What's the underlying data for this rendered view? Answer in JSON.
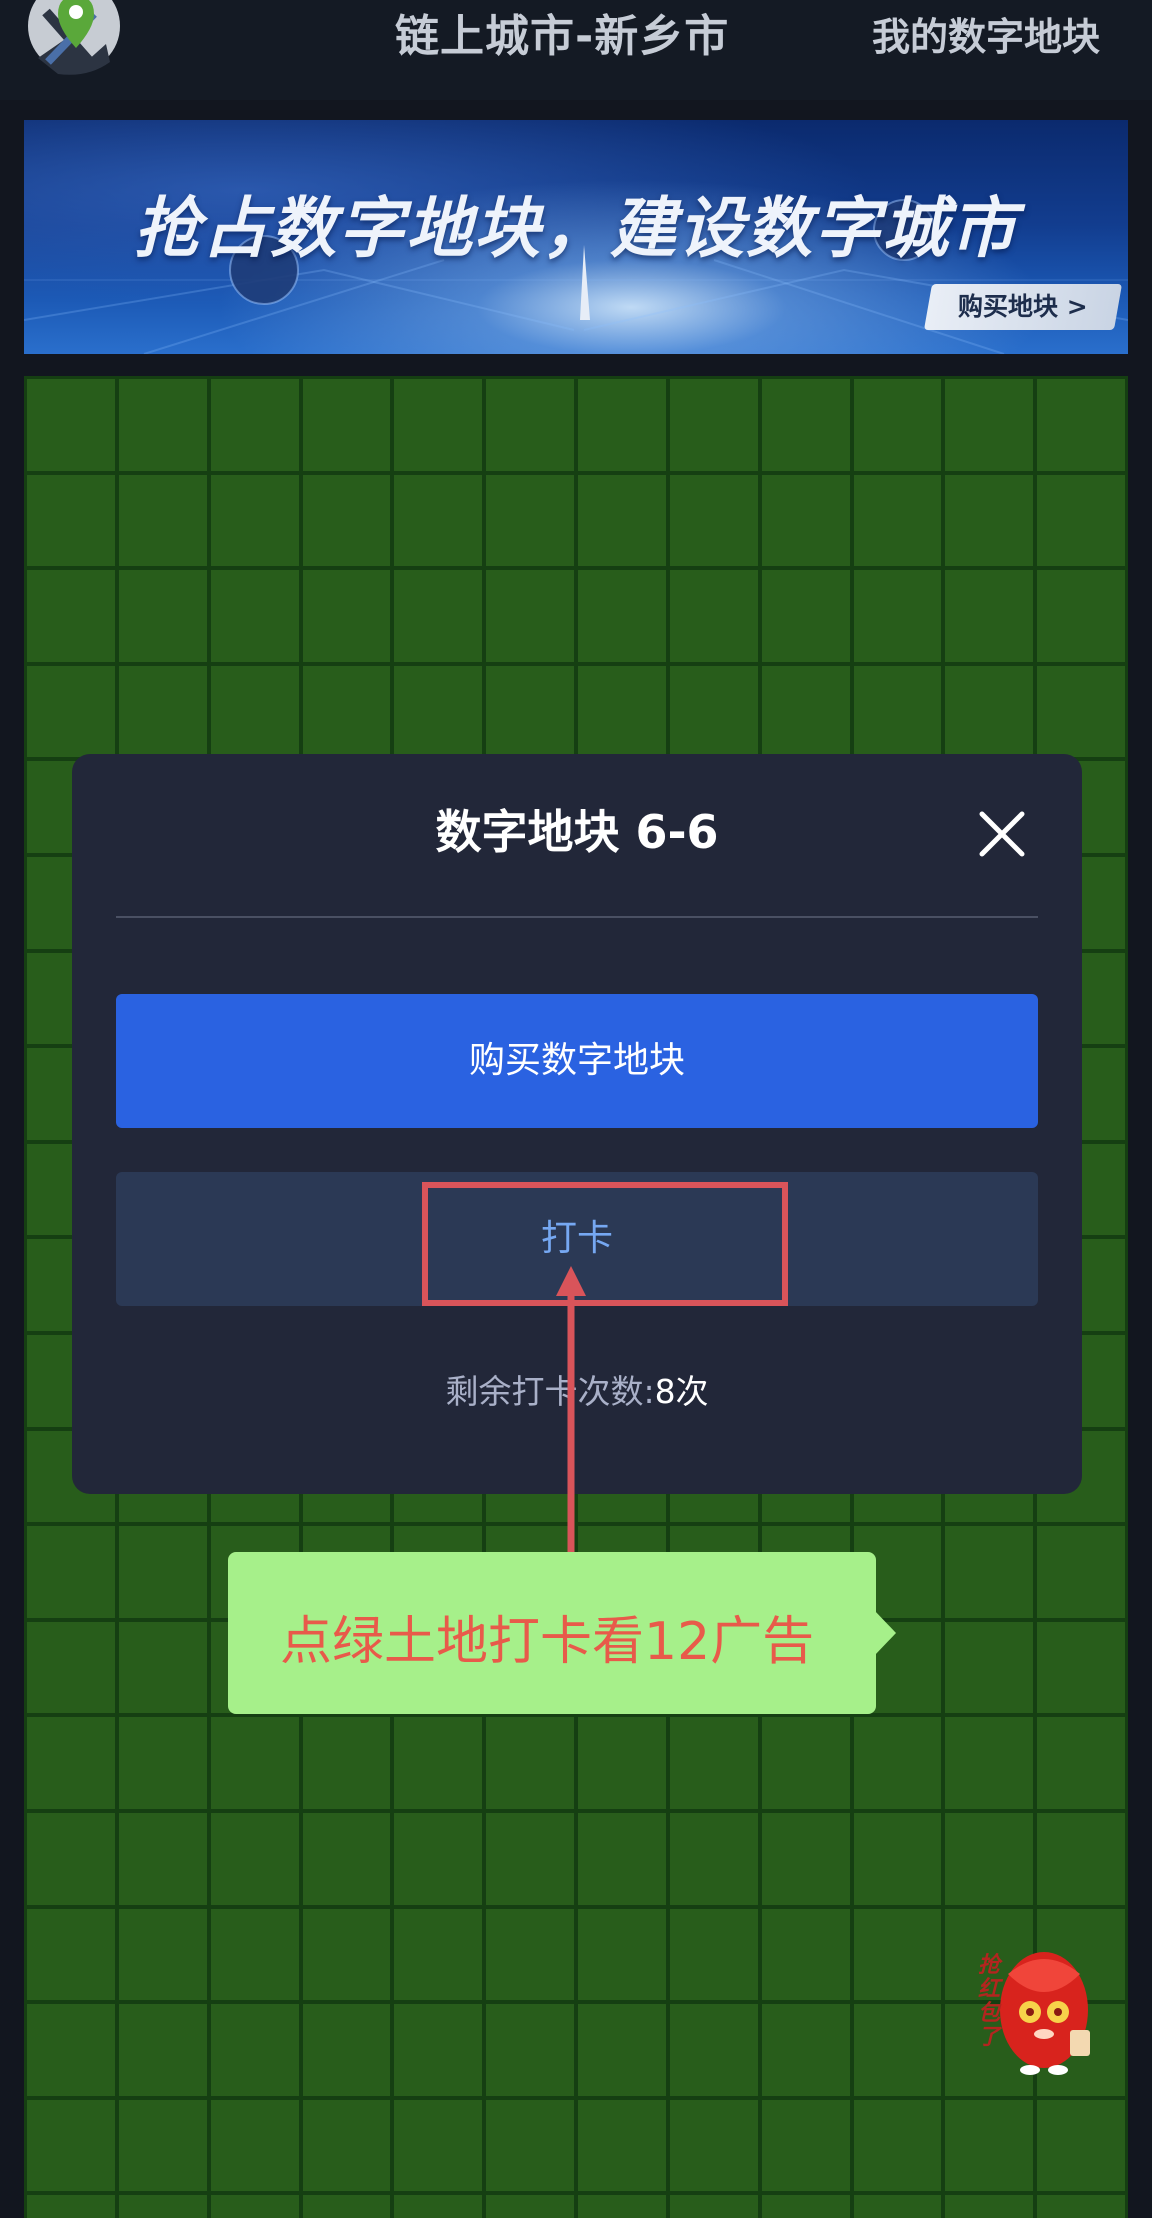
{
  "header": {
    "title": "链上城市-新乡市",
    "my_blocks_label": "我的数字地块"
  },
  "banner": {
    "slogan": "抢占数字地块，建设数字城市",
    "buy_label": "购买地块 >"
  },
  "grid": {
    "columns": 12,
    "rows": 20
  },
  "modal": {
    "title": "数字地块 6-6",
    "buy_button_label": "购买数字地块",
    "checkin_button_label": "打卡",
    "remaining_label": "剩余打卡次数:",
    "remaining_value": "8次"
  },
  "annotation": {
    "callout_text": "点绿土地打卡看12广告"
  },
  "red_envelope": {
    "label": "抢红包了"
  },
  "colors": {
    "page_bg": "#12161f",
    "grid_line": "#153f12",
    "grid_cell": "#285d1b",
    "modal_bg": "#222739",
    "primary_button": "#2a62e1",
    "secondary_button": "#2b3955",
    "secondary_text": "#76a8f2",
    "annotation_red": "#d9545a",
    "callout_green": "#a6f08a"
  },
  "icons": [
    "map-pin-logo-icon",
    "close-icon",
    "red-envelope-mascot-icon"
  ]
}
